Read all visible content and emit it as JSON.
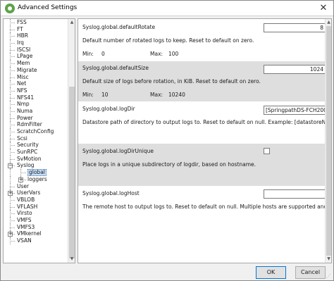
{
  "window": {
    "title": "Advanced Settings",
    "close_label": "✕"
  },
  "tree": {
    "items": [
      {
        "label": "FSS",
        "expandable": false
      },
      {
        "label": "FT",
        "expandable": false
      },
      {
        "label": "HBR",
        "expandable": false
      },
      {
        "label": "Irq",
        "expandable": false
      },
      {
        "label": "ISCSI",
        "expandable": false
      },
      {
        "label": "LPage",
        "expandable": false
      },
      {
        "label": "Mem",
        "expandable": false
      },
      {
        "label": "Migrate",
        "expandable": false
      },
      {
        "label": "Misc",
        "expandable": false
      },
      {
        "label": "Net",
        "expandable": false
      },
      {
        "label": "NFS",
        "expandable": false
      },
      {
        "label": "NFS41",
        "expandable": false
      },
      {
        "label": "Nmp",
        "expandable": false
      },
      {
        "label": "Numa",
        "expandable": false
      },
      {
        "label": "Power",
        "expandable": false
      },
      {
        "label": "RdmFilter",
        "expandable": false
      },
      {
        "label": "ScratchConfig",
        "expandable": false
      },
      {
        "label": "Scsi",
        "expandable": false
      },
      {
        "label": "Security",
        "expandable": false
      },
      {
        "label": "SunRPC",
        "expandable": false
      },
      {
        "label": "SvMotion",
        "expandable": false
      },
      {
        "label": "Syslog",
        "expandable": true,
        "expanded": true
      },
      {
        "label": "global",
        "child": true,
        "selected": true
      },
      {
        "label": "loggers",
        "child": true,
        "expandable": true
      },
      {
        "label": "User",
        "expandable": false
      },
      {
        "label": "UserVars",
        "expandable": true
      },
      {
        "label": "VBLOB",
        "expandable": false
      },
      {
        "label": "VFLASH",
        "expandable": false
      },
      {
        "label": "Virsto",
        "expandable": false
      },
      {
        "label": "VMFS",
        "expandable": false
      },
      {
        "label": "VMFS3",
        "expandable": false
      },
      {
        "label": "VMkernel",
        "expandable": true
      },
      {
        "label": "VSAN",
        "expandable": false
      }
    ]
  },
  "settings": [
    {
      "name": "Syslog.global.defaultRotate",
      "description": "Default number of rotated logs to keep. Reset to default on zero.",
      "value": "8",
      "min_label": "Min:",
      "min": "0",
      "max_label": "Max:",
      "max": "100"
    },
    {
      "name": "Syslog.global.defaultSize",
      "description": "Default size of logs before rotation, in KiB. Reset to default on zero.",
      "value": "1024",
      "min_label": "Min:",
      "min": "10",
      "max_label": "Max:",
      "max": "10240"
    },
    {
      "name": "Syslog.global.logDir",
      "description": "Datastore path of directory to output logs to. Reset to default on null. Example: [datastoreName]/logdir",
      "value": "[SpringpathDS-FCH2002V2"
    },
    {
      "name": "Syslog.global.logDirUnique",
      "description": "Place logs in a unique subdirectory of logdir, based on hostname.",
      "checked": false
    },
    {
      "name": "Syslog.global.logHost",
      "description": "The remote host to output logs to. Reset to default on null. Multiple hosts are supported and must be s",
      "value": ""
    }
  ],
  "buttons": {
    "ok": "OK",
    "cancel": "Cancel"
  }
}
